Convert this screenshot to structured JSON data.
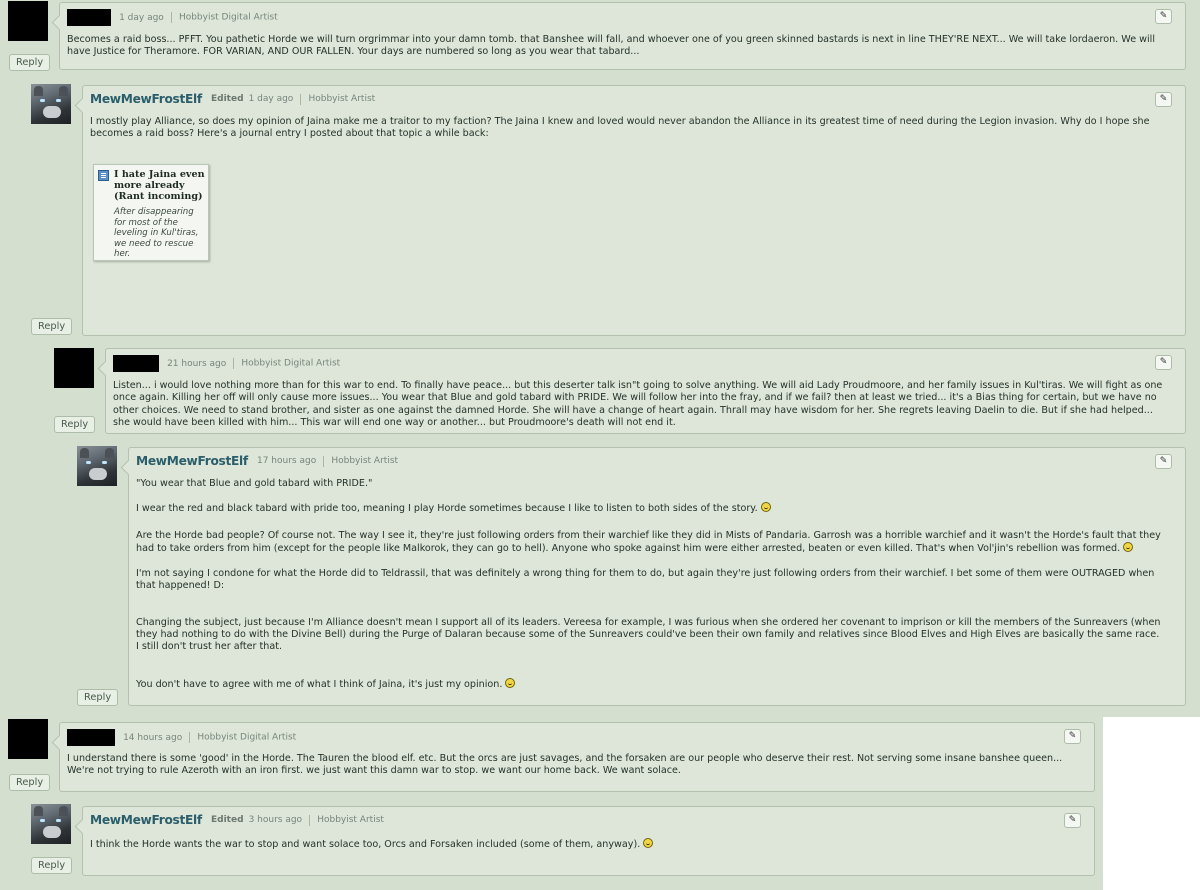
{
  "common": {
    "reply_label": "Reply",
    "role_hobbyist_digital": "Hobbyist Digital Artist",
    "role_hobbyist": "Hobbyist Artist",
    "edited_label": "Edited",
    "edit_glyph": "✎"
  },
  "comments": [
    {
      "username": "",
      "time": "1 day ago",
      "role": "Hobbyist Digital Artist",
      "body": [
        "Becomes a raid boss... PFFT. You pathetic Horde we will turn orgrimmar into your damn tomb.  that Banshee will fall, and whoever one of you green skinned bastards is next in line THEY'RE NEXT... We will take lordaeron. We will have Justice for Theramore. FOR VARIAN, AND OUR FALLEN. Your days are numbered so long as you wear that tabard..."
      ]
    },
    {
      "username": "MewMewFrostElf",
      "edited": "Edited",
      "time": "1 day ago",
      "role": "Hobbyist Artist",
      "body": [
        "I mostly play Alliance, so does my opinion of Jaina make me a traitor to my faction? The Jaina I knew and loved would never abandon the Alliance in its greatest time of need during the Legion invasion.  Why do I hope she becomes a raid boss? Here's a journal entry I posted about that topic a while back:"
      ],
      "journal": {
        "title": "I hate Jaina even more already (Rant incoming)",
        "excerpt": "After disappearing for most of the leveling in Kul'tiras, we need to rescue her."
      }
    },
    {
      "username": "",
      "time": "21 hours ago",
      "role": "Hobbyist Digital Artist",
      "body": [
        "Listen... i would love nothing more than for this war to end. To finally have peace... but this deserter talk isn\"t going to solve anything. We will aid Lady Proudmoore, and her family issues in Kul'tiras. We will fight as one once again.  Killing her off will only cause more issues... You wear that Blue and gold tabard with PRIDE. We will follow her into the fray, and if we fail? then at least we tried... it's a Bias thing for certain, but we have no other choices. We need to stand brother, and sister as one against the damned Horde. She will have a change of heart again. Thrall may have wisdom for her. She regrets leaving Daelin to die. But if she had helped... she would have been killed with him... This war will end one way or another... but Proudmoore's death will not end it."
      ]
    },
    {
      "username": "MewMewFrostElf",
      "time": "17 hours ago",
      "role": "Hobbyist Artist",
      "body": [
        "\"You wear that Blue and gold tabard with PRIDE.\"",
        "I wear the red and black tabard with pride too, meaning I play Horde sometimes because I like to listen to both sides of the story.",
        "Are the Horde bad people? Of course not. The way I see it, they're just following orders from their warchief like they did in Mists of Pandaria. Garrosh was a horrible warchief and it wasn't the Horde's fault  that they had to take orders from him (except for the people like Malkorok, they can go to hell). Anyone who spoke against him were either arrested, beaten or even killed. That's when Vol'jin's rebellion was formed.",
        "I'm not saying I condone for what the Horde did to Teldrassil, that was definitely a wrong thing for them to do, but again they're just following orders from their warchief. I bet some of them were OUTRAGED when that happened! D:",
        "Changing the subject, just because I'm Alliance doesn't mean I support all of its leaders. Vereesa for example, I was furious when she ordered her covenant to imprison or kill the members of the Sunreavers (when they had nothing to do with the Divine Bell) during the Purge of Dalaran because some of the Sunreavers could've been their own family and relatives since Blood Elves and High Elves are basically the same race. I still don't trust her after that.",
        "You don't have to agree with me of what I think of Jaina, it's just my opinion."
      ]
    },
    {
      "username": "",
      "time": "14 hours ago",
      "role": "Hobbyist Digital Artist",
      "body": [
        "I understand there is some 'good' in the Horde. The Tauren the blood elf. etc. But the orcs are just savages, and the forsaken are our people who deserve their rest. Not serving some insane banshee queen... We're not trying to rule Azeroth with an iron first. we just want this damn war to stop. we want our home back. We want solace."
      ]
    },
    {
      "username": "MewMewFrostElf",
      "edited": "Edited",
      "time": "3 hours ago",
      "role": "Hobbyist Artist",
      "body": [
        "I think the Horde wants the war to stop and want solace too, Orcs and Forsaken included (some of them, anyway)."
      ]
    }
  ]
}
